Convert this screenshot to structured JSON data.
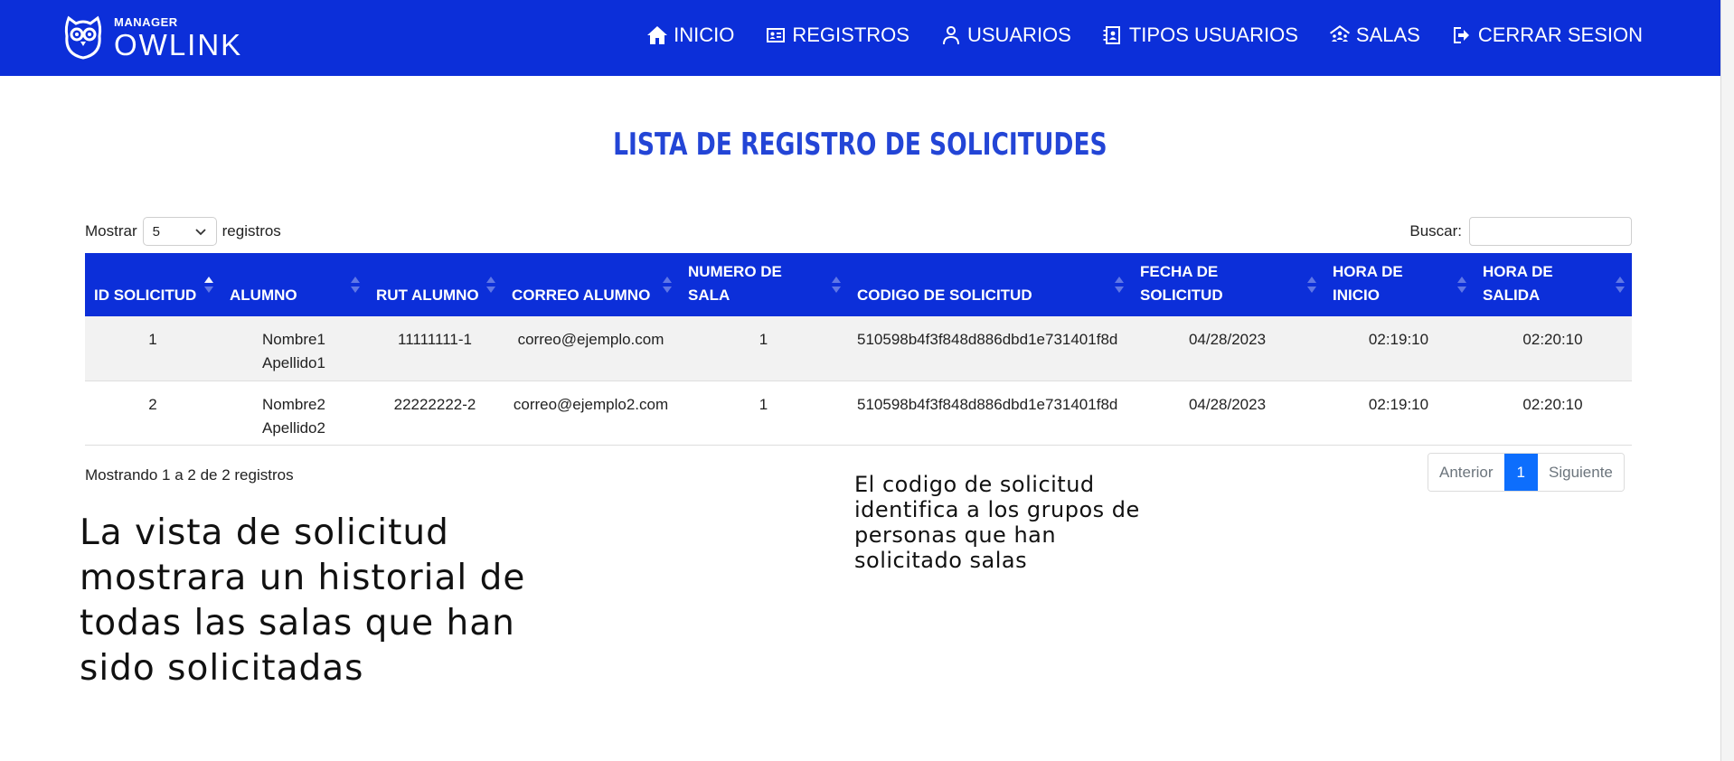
{
  "brand": {
    "sub": "MANAGER",
    "main": "OWLINK"
  },
  "nav": [
    {
      "label": "INICIO",
      "icon": "home-icon"
    },
    {
      "label": "REGISTROS",
      "icon": "id-card-icon"
    },
    {
      "label": "USUARIOS",
      "icon": "user-icon"
    },
    {
      "label": "TIPOS USUARIOS",
      "icon": "contact-book-icon"
    },
    {
      "label": "SALAS",
      "icon": "people-house-icon"
    },
    {
      "label": "CERRAR SESION",
      "icon": "logout-icon"
    }
  ],
  "page_title": "LISTA DE REGISTRO DE SOLICITUDES",
  "controls": {
    "show_prefix": "Mostrar",
    "show_value": "5",
    "show_suffix": "registros",
    "search_label": "Buscar:",
    "search_value": ""
  },
  "table": {
    "headers": [
      "ID SOLICITUD",
      "ALUMNO",
      "RUT ALUMNO",
      "CORREO ALUMNO",
      "NUMERO DE SALA",
      "CODIGO DE SOLICITUD",
      "FECHA DE SOLICITUD",
      "HORA DE INICIO",
      "HORA DE SALIDA"
    ],
    "rows": [
      [
        "1",
        "Nombre1 Apellido1",
        "11111111-1",
        "correo@ejemplo.com",
        "1",
        "510598b4f3f848d886dbd1e731401f8d",
        "04/28/2023",
        "02:19:10",
        "02:20:10"
      ],
      [
        "2",
        "Nombre2 Apellido2",
        "22222222-2",
        "correo@ejemplo2.com",
        "1",
        "510598b4f3f848d886dbd1e731401f8d",
        "04/28/2023",
        "02:19:10",
        "02:20:10"
      ]
    ]
  },
  "info_text": "Mostrando 1 a 2 de 2 registros",
  "pagination": {
    "prev": "Anterior",
    "current": "1",
    "next": "Siguiente"
  },
  "notes": {
    "left": "La vista de solicitud mostrara un historial de todas las salas que han sido solicitadas",
    "middle": "El codigo de solicitud identifica a los grupos de personas que han solicitado salas"
  },
  "colors": {
    "navbar": "#0c2fd9",
    "title": "#2345d6",
    "active_page": "#0d6efd"
  }
}
